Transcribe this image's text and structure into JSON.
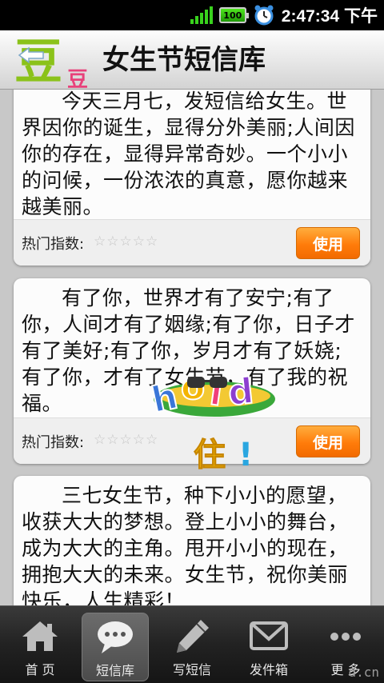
{
  "status_bar": {
    "battery": "100",
    "time": "2:47:34 下午"
  },
  "header": {
    "logo_text": "豆",
    "title": "女生节短信库"
  },
  "messages": [
    {
      "text": "今天三月七，发短信给女生。世界因你的诞生，显得分外美丽;人间因你的存在，显得异常奇妙。一个小小的问候，一份浓浓的真意，愿你越来越美丽。",
      "hot_label": "热门指数:",
      "rating": 0,
      "button": "使用"
    },
    {
      "text": "有了你，世界才有了安宁;有了你，人间才有了姻缘;有了你，日子才有了美好;有了你，岁月才有了妖娆;有了你，才有了女生节，有了我的祝福。",
      "hot_label": "热门指数:",
      "rating": 0,
      "button": "使用"
    },
    {
      "text": "三七女生节，种下小小的愿望，收获大大的梦想。登上小小的舞台，成为大大的主角。甩开小小的现在，拥抱大大的未来。女生节，祝你美丽快乐，人生精彩！",
      "hot_label": "",
      "rating": 0,
      "button": ""
    }
  ],
  "sticker": {
    "line1": "hold",
    "line2": "住！"
  },
  "tabs": [
    {
      "label": "首 页",
      "icon": "home-icon",
      "active": false
    },
    {
      "label": "短信库",
      "icon": "chat-bubble-icon",
      "active": true
    },
    {
      "label": "写短信",
      "icon": "pencil-icon",
      "active": false
    },
    {
      "label": "发件箱",
      "icon": "envelope-icon",
      "active": false
    },
    {
      "label": "更 多",
      "icon": "more-dots-icon",
      "active": false
    }
  ],
  "watermark": "d.cn",
  "colors": {
    "accent_orange": "#ff7c0a",
    "logo_green": "#8bc21a",
    "logo_pink": "#e8417a",
    "signal_green": "#39d21d"
  }
}
